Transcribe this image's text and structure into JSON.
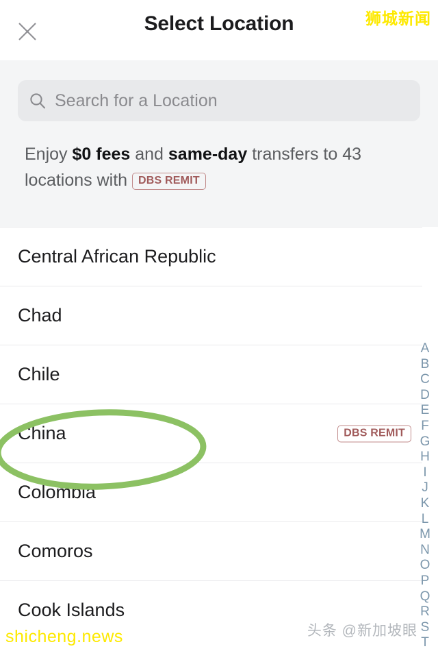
{
  "header": {
    "title": "Select Location",
    "close_icon": "close-icon"
  },
  "search": {
    "icon": "search-icon",
    "placeholder": "Search for a Location",
    "value": ""
  },
  "promo": {
    "prefix": "Enjoy ",
    "bold_1": "$0 fees",
    "middle": " and ",
    "bold_2": "same-day",
    "suffix": " transfers to 43 locations with ",
    "badge": "DBS REMIT"
  },
  "list": {
    "items": [
      {
        "label": "Central African Republic",
        "badge": ""
      },
      {
        "label": "Chad",
        "badge": ""
      },
      {
        "label": "Chile",
        "badge": ""
      },
      {
        "label": "China",
        "badge": "DBS REMIT"
      },
      {
        "label": "Colombia",
        "badge": ""
      },
      {
        "label": "Comoros",
        "badge": ""
      },
      {
        "label": "Cook Islands",
        "badge": ""
      }
    ]
  },
  "index": {
    "letters": [
      "A",
      "B",
      "C",
      "D",
      "E",
      "F",
      "G",
      "H",
      "I",
      "J",
      "K",
      "L",
      "M",
      "N",
      "O",
      "P",
      "Q",
      "R",
      "S",
      "T"
    ]
  },
  "annotation": {
    "shape": "ellipse",
    "target": "China",
    "color": "#8cc163"
  },
  "watermarks": {
    "top_right": "狮城新闻",
    "bottom_left": "shicheng.news",
    "bottom_right": "头条 @新加坡眼"
  },
  "colors": {
    "accent_green": "#8cc163",
    "badge_border": "#c08a8a",
    "badge_text": "#a05a5a",
    "index_text": "#7b96ab",
    "section_bg": "#f4f5f6",
    "search_bg": "#e8e9eb",
    "watermark_yellow": "#fde900"
  }
}
